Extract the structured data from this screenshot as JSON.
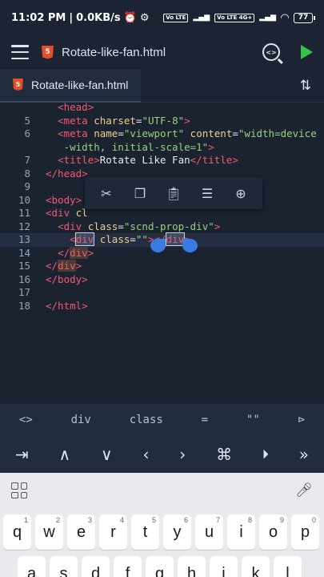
{
  "status": {
    "time": "11:02 PM",
    "speed": "0.0KB/s",
    "battery": "77",
    "sim1": "Vo LTE",
    "sim2": "Vo LTE 4G+"
  },
  "appbar": {
    "title": "Rotate-like-fan.html",
    "badge": "5"
  },
  "tab": {
    "label": "Rotate-like-fan.html",
    "badge": "5"
  },
  "editor": {
    "lines": [
      {
        "n": "",
        "parts": [
          {
            "c": "txt",
            "t": "  "
          },
          {
            "c": "tag",
            "t": "<head>"
          }
        ]
      },
      {
        "n": "5",
        "parts": [
          {
            "c": "txt",
            "t": "  "
          },
          {
            "c": "tag",
            "t": "<meta"
          },
          {
            "c": "attr",
            "t": " charset"
          },
          {
            "c": "txt",
            "t": "="
          },
          {
            "c": "str",
            "t": "\"UTF-8\""
          },
          {
            "c": "tag",
            "t": ">"
          }
        ]
      },
      {
        "n": "6",
        "parts": [
          {
            "c": "txt",
            "t": "  "
          },
          {
            "c": "tag",
            "t": "<meta"
          },
          {
            "c": "attr",
            "t": " name"
          },
          {
            "c": "txt",
            "t": "="
          },
          {
            "c": "str",
            "t": "\"viewport\""
          },
          {
            "c": "attr",
            "t": " content"
          },
          {
            "c": "txt",
            "t": "="
          },
          {
            "c": "str",
            "t": "\"width=device"
          }
        ]
      },
      {
        "n": "",
        "parts": [
          {
            "c": "str",
            "t": "   -width, initial-scale=1\""
          },
          {
            "c": "tag",
            "t": ">"
          }
        ]
      },
      {
        "n": "7",
        "parts": [
          {
            "c": "txt",
            "t": "  "
          },
          {
            "c": "tag",
            "t": "<title>"
          },
          {
            "c": "txt",
            "t": "Rotate Like Fan"
          },
          {
            "c": "tag",
            "t": "</title>"
          }
        ]
      },
      {
        "n": "8",
        "parts": [
          {
            "c": "tag",
            "t": "</head>"
          }
        ]
      },
      {
        "n": "9",
        "parts": []
      },
      {
        "n": "10",
        "parts": [
          {
            "c": "tag",
            "t": "<body>"
          }
        ]
      },
      {
        "n": "11",
        "parts": [
          {
            "c": "tag",
            "t": "<div"
          },
          {
            "c": "attr",
            "t": " cl"
          }
        ]
      },
      {
        "n": "12",
        "parts": [
          {
            "c": "txt",
            "t": "  "
          },
          {
            "c": "tag",
            "t": "<div"
          },
          {
            "c": "attr",
            "t": " class"
          },
          {
            "c": "txt",
            "t": "="
          },
          {
            "c": "str",
            "t": "\"scnd-prop-div\""
          },
          {
            "c": "tag",
            "t": ">"
          }
        ]
      },
      {
        "n": "13",
        "parts": [
          {
            "c": "txt",
            "t": "    "
          },
          {
            "c": "tag",
            "t": "<"
          },
          {
            "c": "tag sel",
            "t": "div"
          },
          {
            "c": "attr",
            "t": " class"
          },
          {
            "c": "txt",
            "t": "="
          },
          {
            "c": "str",
            "t": "\"\""
          },
          {
            "c": "tag",
            "t": "></"
          },
          {
            "c": "tag sel",
            "t": "div"
          },
          {
            "c": "tag",
            "t": ">"
          }
        ]
      },
      {
        "n": "14",
        "parts": [
          {
            "c": "txt",
            "t": "  "
          },
          {
            "c": "tag",
            "t": "</"
          },
          {
            "c": "tag hl",
            "t": "div"
          },
          {
            "c": "tag",
            "t": ">"
          }
        ]
      },
      {
        "n": "15",
        "parts": [
          {
            "c": "tag",
            "t": "</"
          },
          {
            "c": "tag hl",
            "t": "div"
          },
          {
            "c": "tag",
            "t": ">"
          }
        ]
      },
      {
        "n": "16",
        "parts": [
          {
            "c": "tag",
            "t": "</body>"
          }
        ]
      },
      {
        "n": "17",
        "parts": []
      },
      {
        "n": "18",
        "parts": [
          {
            "c": "tag",
            "t": "</html>"
          }
        ]
      }
    ],
    "current_line": "13"
  },
  "popup": {
    "items": [
      "cut-icon",
      "copy-icon",
      "paste-icon",
      "select-all-icon",
      "globe-icon"
    ]
  },
  "symbols": [
    "<>",
    "div",
    "class",
    "=",
    "\"\"",
    "⊳"
  ],
  "nav": [
    "⇥",
    "∧",
    "∨",
    "‹",
    "›",
    "⌘",
    "⏵",
    "»"
  ],
  "keyboard": {
    "row1": [
      {
        "k": "q",
        "n": "1"
      },
      {
        "k": "w",
        "n": "2"
      },
      {
        "k": "e",
        "n": "3"
      },
      {
        "k": "r",
        "n": "4"
      },
      {
        "k": "t",
        "n": "5"
      },
      {
        "k": "y",
        "n": "6"
      },
      {
        "k": "u",
        "n": "7"
      },
      {
        "k": "i",
        "n": "8"
      },
      {
        "k": "o",
        "n": "9"
      },
      {
        "k": "p",
        "n": "0"
      }
    ],
    "row2": [
      "a",
      "s",
      "d",
      "f",
      "g",
      "h",
      "j",
      "k",
      "l"
    ]
  },
  "colors": {
    "background": "#1b2331",
    "tag": "#ef5b6b",
    "attribute": "#e7d38b",
    "string": "#9ad17a",
    "run": "#38c24a",
    "html5": "#e44d26"
  }
}
